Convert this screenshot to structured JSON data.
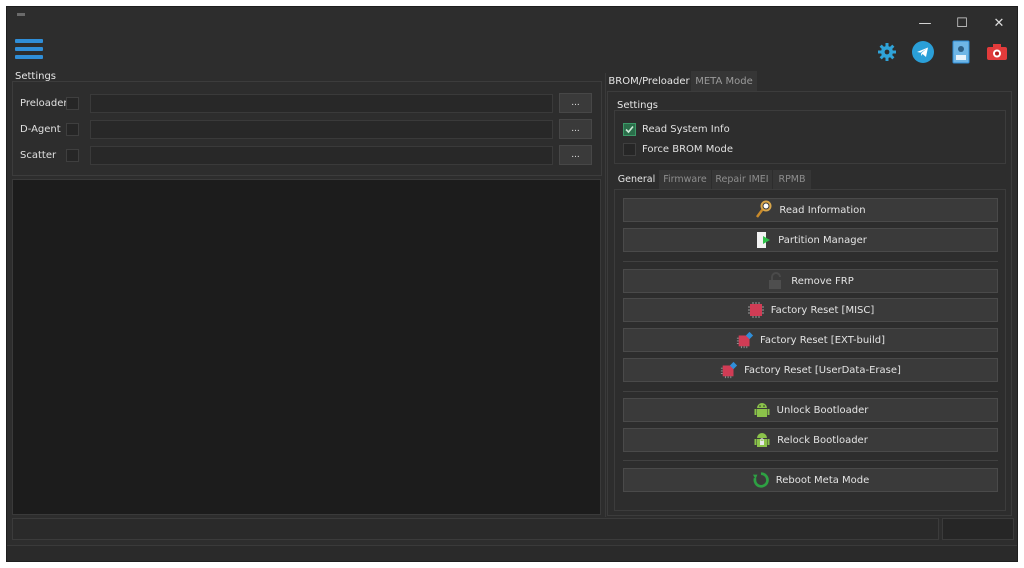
{
  "window": {
    "controls": {
      "minimize": "—",
      "maximize": "☐",
      "close": "✕"
    }
  },
  "toolbar": {
    "icons": [
      "menu-icon",
      "settings-gear-icon",
      "telegram-icon",
      "log-file-icon",
      "screenshot-camera-icon"
    ],
    "accent_color": "#2f8ed8"
  },
  "left": {
    "settings_label": "Settings",
    "rows": [
      {
        "label": "Preloader",
        "value": "",
        "browse": "..."
      },
      {
        "label": "D-Agent",
        "value": "",
        "browse": "..."
      },
      {
        "label": "Scatter",
        "value": "",
        "browse": "..."
      }
    ]
  },
  "right": {
    "tabs": [
      {
        "label": "BROM/Preloader",
        "active": true
      },
      {
        "label": "META Mode",
        "active": false
      }
    ],
    "settings_label": "Settings",
    "options": [
      {
        "label": "Read System Info",
        "checked": true
      },
      {
        "label": "Force BROM Mode",
        "checked": false
      }
    ],
    "subtabs": [
      {
        "label": "General",
        "active": true
      },
      {
        "label": "Firmware",
        "active": false
      },
      {
        "label": "Repair IMEI",
        "active": false
      },
      {
        "label": "RPMB",
        "active": false
      }
    ],
    "buttons": {
      "read_information": "Read Information",
      "partition_manager": "Partition Manager",
      "remove_frp": "Remove FRP",
      "factory_reset_misc": "Factory Reset [MISC]",
      "factory_reset_ext": "Factory Reset [EXT-build]",
      "factory_reset_userdata": "Factory Reset [UserData-Erase]",
      "unlock_bootloader": "Unlock Bootloader",
      "relock_bootloader": "Relock Bootloader",
      "reboot_meta": "Reboot Meta Mode"
    }
  }
}
